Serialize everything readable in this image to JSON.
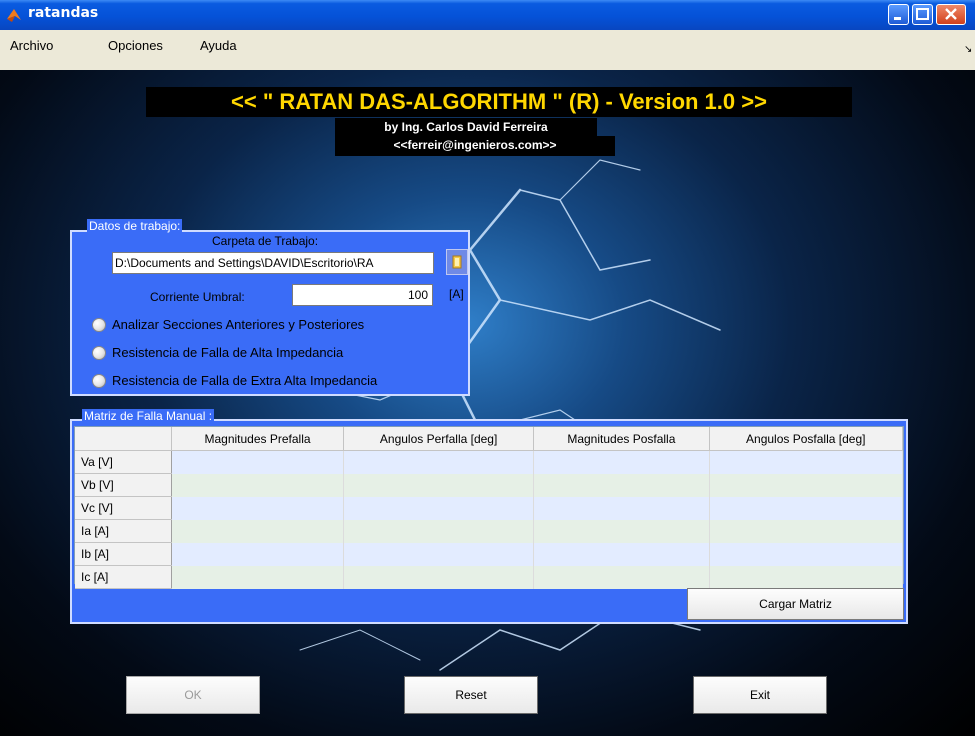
{
  "window": {
    "title": "ratandas",
    "icon": "matlab-icon"
  },
  "menu": {
    "items": [
      "Archivo",
      "Opciones",
      "Ayuda"
    ]
  },
  "header": {
    "title": "<< \" RATAN DAS-ALGORITHM \" (R) - Version 1.0 >>",
    "author": "by Ing. Carlos David Ferreira",
    "email": "<<ferreir@ingenieros.com>>"
  },
  "datos": {
    "panel_label": "Datos de trabajo:",
    "carpeta_label": "Carpeta de Trabajo:",
    "carpeta_value": "D:\\Documents and Settings\\DAVID\\Escritorio\\RA",
    "umbral_label": "Corriente Umbral:",
    "umbral_value": "100",
    "umbral_unit": "[A]",
    "radios": [
      "Analizar Secciones Anteriores y Posteriores",
      "Resistencia de Falla de Alta Impedancia",
      "Resistencia de Falla de Extra Alta Impedancia"
    ]
  },
  "matriz": {
    "panel_label": "Matriz de Falla Manual :",
    "columns": [
      "Magnitudes Prefalla",
      "Angulos Perfalla [deg]",
      "Magnitudes Posfalla",
      "Angulos Posfalla [deg]"
    ],
    "rows": [
      "Va [V]",
      "Vb [V]",
      "Vc [V]",
      "Ia [A]",
      "Ib [A]",
      "Ic [A]"
    ],
    "cargar_label": "Cargar Matriz"
  },
  "buttons": {
    "ok": "OK",
    "reset": "Reset",
    "exit": "Exit"
  },
  "colors": {
    "panel": "#3a6cf7",
    "title_yellow": "#ffd700"
  }
}
